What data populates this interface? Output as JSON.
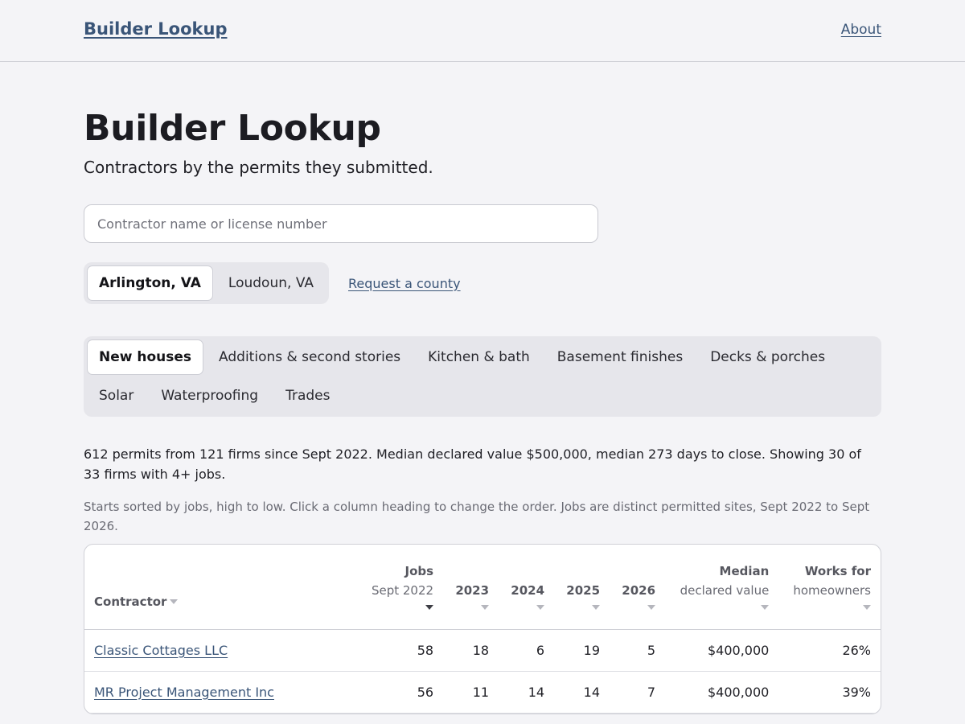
{
  "header": {
    "brand": "Builder Lookup",
    "about": "About"
  },
  "page": {
    "title": "Builder Lookup",
    "subtitle": "Contractors by the permits they submitted."
  },
  "search": {
    "placeholder": "Contractor name or license number",
    "value": ""
  },
  "counties": {
    "items": [
      {
        "label": "Arlington, VA",
        "active": true
      },
      {
        "label": "Loudoun, VA",
        "active": false
      }
    ],
    "request_link": "Request a county"
  },
  "categories": [
    {
      "label": "New houses",
      "active": true
    },
    {
      "label": "Additions & second stories",
      "active": false
    },
    {
      "label": "Kitchen & bath",
      "active": false
    },
    {
      "label": "Basement finishes",
      "active": false
    },
    {
      "label": "Decks & porches",
      "active": false
    },
    {
      "label": "Solar",
      "active": false
    },
    {
      "label": "Waterproofing",
      "active": false
    },
    {
      "label": "Trades",
      "active": false
    }
  ],
  "summary": "612 permits from 121 firms since Sept 2022. Median declared value $500,000, median 273 days to close. Showing 30 of 33 firms with 4+ jobs.",
  "note": "Starts sorted by jobs, high to low. Click a column heading to change the order. Jobs are distinct permitted sites, Sept 2022 to Sept 2026.",
  "table": {
    "columns": {
      "contractor": "Contractor",
      "jobs": "Jobs",
      "jobs_sub": "Sept 2022",
      "y2023": "2023",
      "y2024": "2024",
      "y2025": "2025",
      "y2026": "2026",
      "median": "Median",
      "median_sub": "declared value",
      "works": "Works for",
      "works_sub": "homeowners"
    },
    "sorted_by": "jobs",
    "rows": [
      {
        "name": "Classic Cottages LLC",
        "jobs": "58",
        "y2023": "18",
        "y2024": "6",
        "y2025": "19",
        "y2026": "5",
        "median": "$400,000",
        "works": "26%"
      },
      {
        "name": "MR Project Management Inc",
        "jobs": "56",
        "y2023": "11",
        "y2024": "14",
        "y2025": "14",
        "y2026": "7",
        "median": "$400,000",
        "works": "39%"
      }
    ]
  }
}
